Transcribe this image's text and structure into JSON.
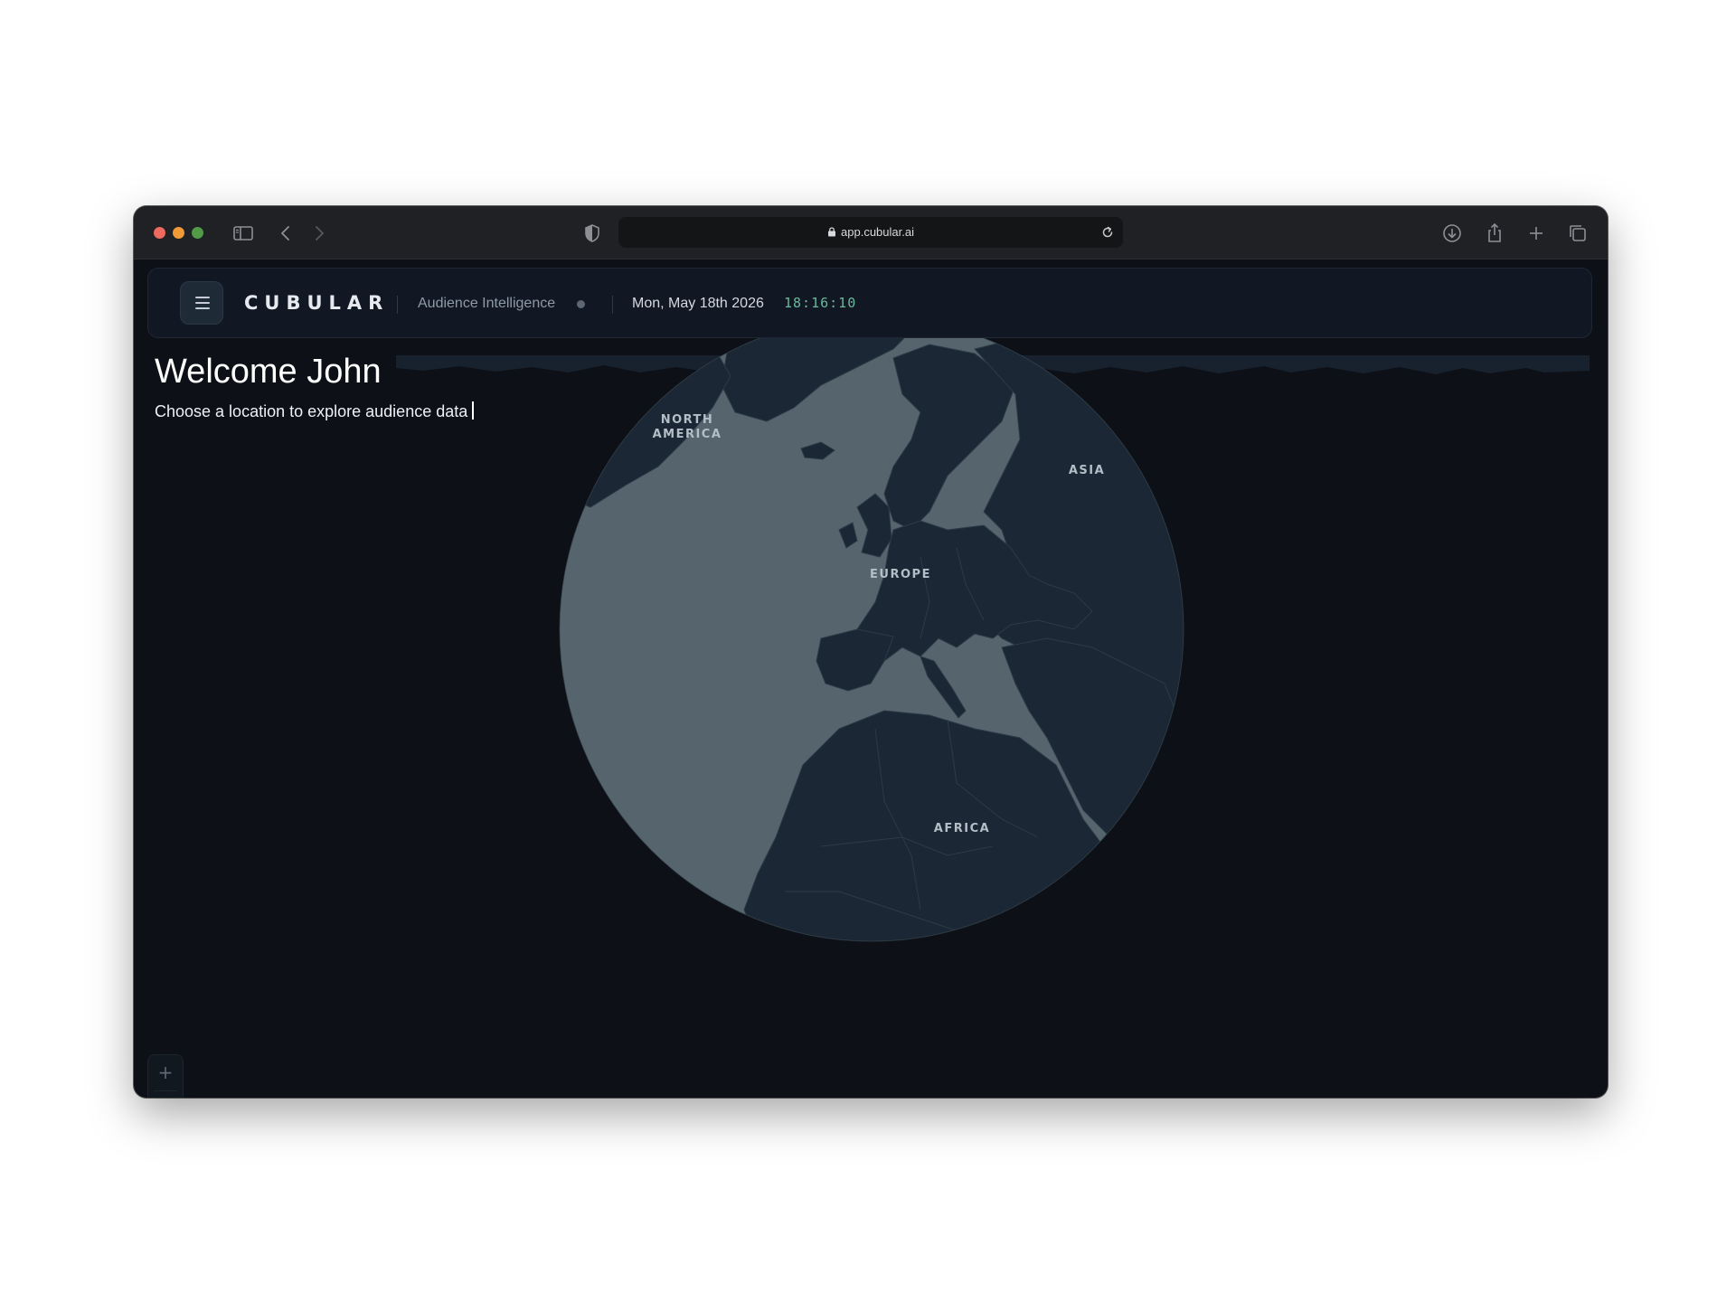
{
  "browser": {
    "url": "app.cubular.ai",
    "icons": [
      "sidebar-icon",
      "back-icon",
      "forward-icon",
      "shield-icon",
      "lock-icon",
      "reload-icon",
      "download-icon",
      "share-icon",
      "new-tab-icon",
      "tabs-overview-icon"
    ]
  },
  "header": {
    "brand": "CUBULAR",
    "subtitle": "Audience Intelligence",
    "date": "Mon, May 18th 2026",
    "time": "18:16:10"
  },
  "welcome": {
    "title": "Welcome John",
    "subtitle": "Choose a location to explore audience data"
  },
  "map": {
    "labels": {
      "north_america_line1": "NORTH",
      "north_america_line2": "AMERICA",
      "asia": "ASIA",
      "europe": "EUROPE",
      "africa": "AFRICA"
    },
    "zoom_in": "+",
    "zoom_out": "–"
  },
  "colors": {
    "background": "#0d1117",
    "ocean": "#56656d",
    "land": "#1b2734",
    "accent_time": "#6bb89a"
  }
}
